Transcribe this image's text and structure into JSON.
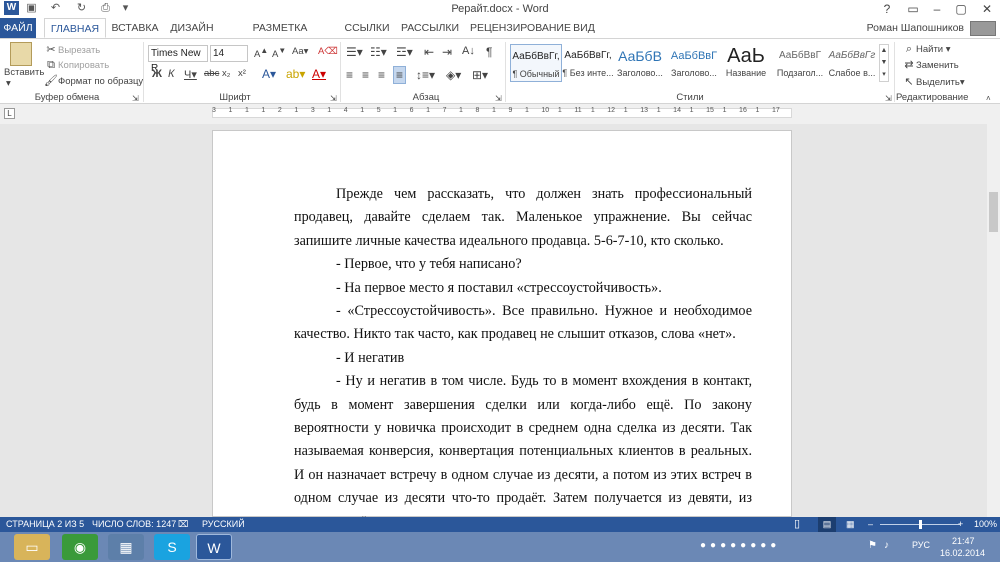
{
  "titlebar": {
    "title": "Рерайт.docx - Word"
  },
  "tabs": [
    "ФАЙЛ",
    "ГЛАВНАЯ",
    "ВСТАВКА",
    "ДИЗАЙН",
    "РАЗМЕТКА СТРАНИЦЫ",
    "ССЫЛКИ",
    "РАССЫЛКИ",
    "РЕЦЕНЗИРОВАНИЕ",
    "ВИД"
  ],
  "user": "Роман Шапошников",
  "clipboard": {
    "paste": "Вставить",
    "cut": "Вырезать",
    "copy": "Копировать",
    "format": "Формат по образцу",
    "group": "Буфер обмена"
  },
  "font": {
    "name": "Times New R",
    "size": "14",
    "group": "Шрифт"
  },
  "paragraph": {
    "group": "Абзац"
  },
  "styles": {
    "group": "Стили",
    "items": [
      {
        "sample": "АаБбВвГг,",
        "name": "¶ Обычный"
      },
      {
        "sample": "АаБбВвГг,",
        "name": "¶ Без инте..."
      },
      {
        "sample": "АаБбВ",
        "name": "Заголово..."
      },
      {
        "sample": "АаБбВвГ",
        "name": "Заголово..."
      },
      {
        "sample": "АаЬ",
        "name": "Название"
      },
      {
        "sample": "АаБбВвГ",
        "name": "Подзагол..."
      },
      {
        "sample": "АаБбВвГг",
        "name": "Слабое в..."
      }
    ]
  },
  "editing": {
    "find": "Найти",
    "replace": "Заменить",
    "select": "Выделить",
    "group": "Редактирование"
  },
  "ruler": {
    "marks": [
      "3",
      "1",
      "1",
      "1",
      "2",
      "1",
      "3",
      "1",
      "4",
      "1",
      "5",
      "1",
      "6",
      "1",
      "7",
      "1",
      "8",
      "1",
      "9",
      "1",
      "10",
      "1",
      "11",
      "1",
      "12",
      "1",
      "13",
      "1",
      "14",
      "1",
      "15",
      "1",
      "16",
      "1",
      "17"
    ]
  },
  "document": {
    "paragraphs": [
      {
        "indent": true,
        "text": "Прежде чем рассказать, что должен знать профессиональный продавец, давайте сделаем так. Маленькое упражнение. Вы сейчас запишите личные качества идеального продавца. 5-6-7-10, кто сколько."
      },
      {
        "indent": true,
        "text": "- Первое, что у тебя написано?"
      },
      {
        "indent": true,
        "text": "- На первое место я поставил «стрессоустойчивость»."
      },
      {
        "indent": true,
        "text": "- «Стрессоустойчивость». Все правильно. Нужное и необходимое качество. Никто так часто, как продавец не слышит отказов, слова «нет»."
      },
      {
        "indent": true,
        "text": "- И негатив"
      },
      {
        "indent": true,
        "text": "- Ну и негатив в том числе. Будь то в момент вхождения в контакт, будь в момент завершения сделки или когда-либо ещё. По закону вероятности у новичка происходит в среднем одна сделка из десяти. Так называемая конверсия, конвертация потенциальных клиентов в реальных. И он назначает встречу в одном случае из десяти, а потом из этих встреч в одном случае из десяти что-то продаёт. Затем получается из девяти, из семи, из трёх, и так"
      }
    ]
  },
  "status": {
    "page": "СТРАНИЦА 2 ИЗ 5",
    "words": "ЧИСЛО СЛОВ: 1247",
    "lang": "РУССКИЙ",
    "zoom": "100%",
    "zoom_level": 0.5
  },
  "tray": {
    "lang": "РУС",
    "time": "21:47",
    "date": "16.02.2014"
  }
}
